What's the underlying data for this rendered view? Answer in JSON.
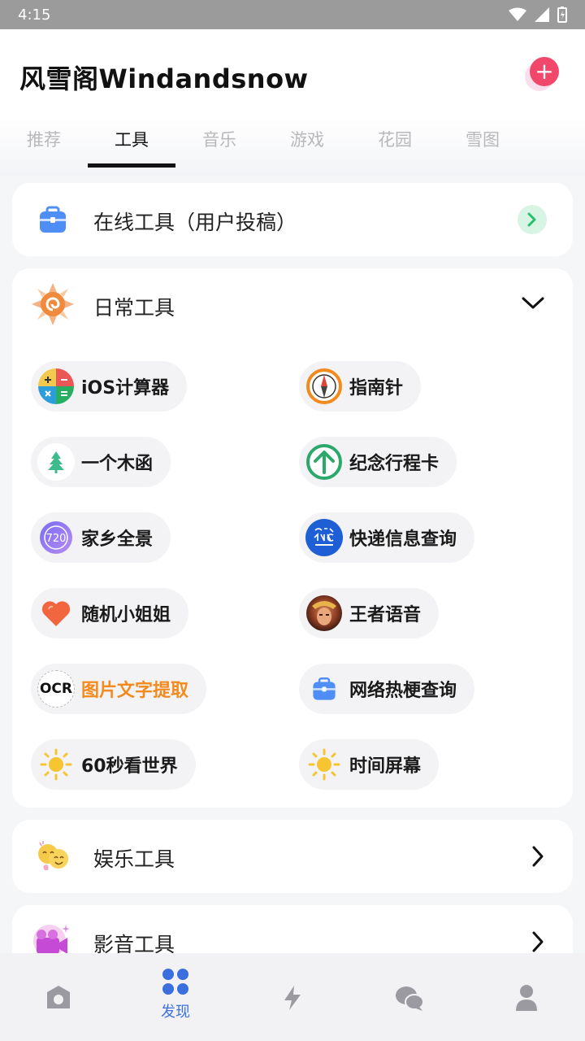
{
  "status": {
    "time": "4:15"
  },
  "header": {
    "title": "风雪阁Windandsnow"
  },
  "tabs": [
    {
      "label": "推荐"
    },
    {
      "label": "工具"
    },
    {
      "label": "音乐"
    },
    {
      "label": "游戏"
    },
    {
      "label": "花园"
    },
    {
      "label": "雪图"
    }
  ],
  "online_tools": {
    "label": "在线工具（用户投稿）"
  },
  "daily_tools": {
    "label": "日常工具",
    "items": [
      {
        "label": "iOS计算器",
        "icon": "calculator-icon"
      },
      {
        "label": "指南针",
        "icon": "compass-icon"
      },
      {
        "label": "一个木函",
        "icon": "tree-icon"
      },
      {
        "label": "纪念行程卡",
        "icon": "arrow-up-circle-icon"
      },
      {
        "label": "家乡全景",
        "icon": "panorama-720-icon"
      },
      {
        "label": "快递信息查询",
        "icon": "cainiao-icon"
      },
      {
        "label": "随机小姐姐",
        "icon": "heart-icon"
      },
      {
        "label": "王者语音",
        "icon": "hero-avatar-icon"
      },
      {
        "label": "图片文字提取",
        "icon": "ocr-icon",
        "accent": "#f28a1e"
      },
      {
        "label": "网络热梗查询",
        "icon": "toolbox-icon"
      },
      {
        "label": "60秒看世界",
        "icon": "sun-icon"
      },
      {
        "label": "时间屏幕",
        "icon": "sun-icon"
      }
    ],
    "ocr_text": "OCR",
    "pano_text": "720"
  },
  "entertainment_tools": {
    "label": "娱乐工具"
  },
  "media_tools": {
    "label": "影音工具"
  },
  "bottom_nav": {
    "discover_label": "发现"
  },
  "colors": {
    "accent_blue": "#3b6fe0",
    "accent_orange": "#f28a1e",
    "add_pink": "#f0476b"
  }
}
